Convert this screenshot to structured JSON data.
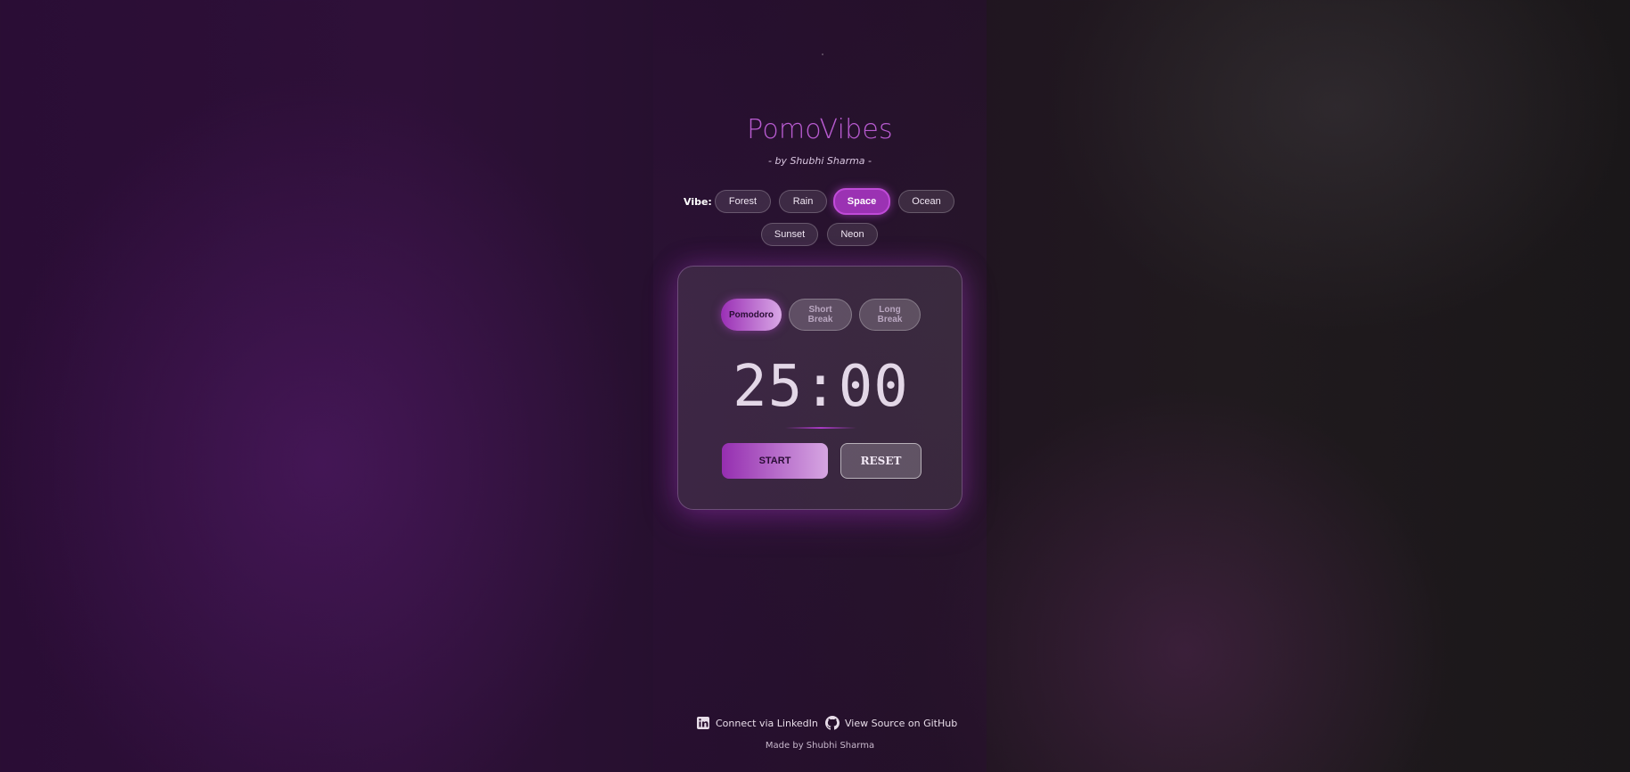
{
  "app": {
    "title": "PomoVibes",
    "subtitle": "- by Shubhi Sharma -"
  },
  "vibes": {
    "label": "Vibe:",
    "options": [
      "Forest",
      "Rain",
      "Space",
      "Ocean",
      "Sunset",
      "Neon"
    ],
    "selected": "Space"
  },
  "timer": {
    "modes": [
      "Pomodoro",
      "Short Break",
      "Long Break"
    ],
    "active_mode": "Pomodoro",
    "display": "25:00",
    "start_label": "START",
    "reset_label": "RESET"
  },
  "footer": {
    "linkedin_label": "Connect via LinkedIn",
    "github_label": "View Source on GitHub",
    "made_by": "Made by Shubhi Sharma"
  },
  "colors": {
    "accent": "#9b32b3",
    "title": "#b85bd0",
    "background": "#2a0d35"
  },
  "icons": {
    "linkedin": "linkedin-icon",
    "github": "github-icon"
  }
}
